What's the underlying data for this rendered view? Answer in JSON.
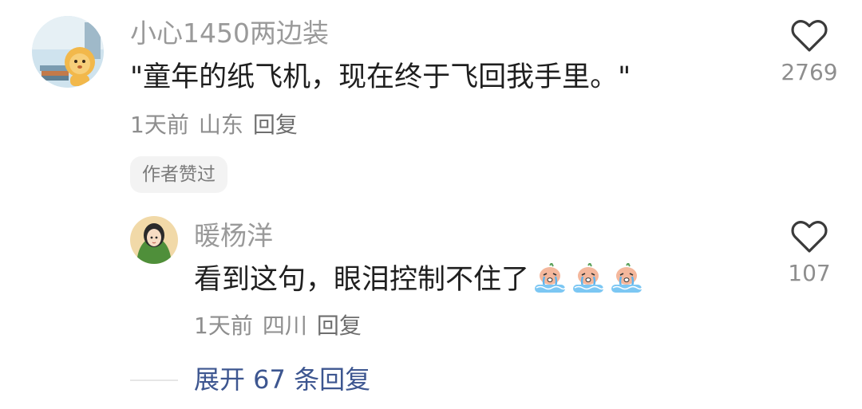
{
  "comment": {
    "username": "小心1450两边装",
    "text": "\"童年的纸飞机，现在终于飞回我手里。\"",
    "time": "1天前",
    "location": "山东",
    "reply_label": "回复",
    "badge": "作者赞过",
    "like_count": "2769",
    "avatar_icon": "cartoon-lion-avatar"
  },
  "reply": {
    "username": "暖杨洋",
    "text": "看到这句，眼泪控制不住了",
    "emoji_icon": "crying-face-emoji",
    "emoji_count": 3,
    "time": "1天前",
    "location": "四川",
    "reply_label": "回复",
    "like_count": "107",
    "avatar_icon": "illustrated-girl-avatar"
  },
  "expand_label": "展开 67 条回复",
  "colors": {
    "text_primary": "#1f1f1f",
    "text_secondary": "#9a9a9a",
    "link": "#3d5690",
    "badge_bg": "#f3f3f3"
  }
}
